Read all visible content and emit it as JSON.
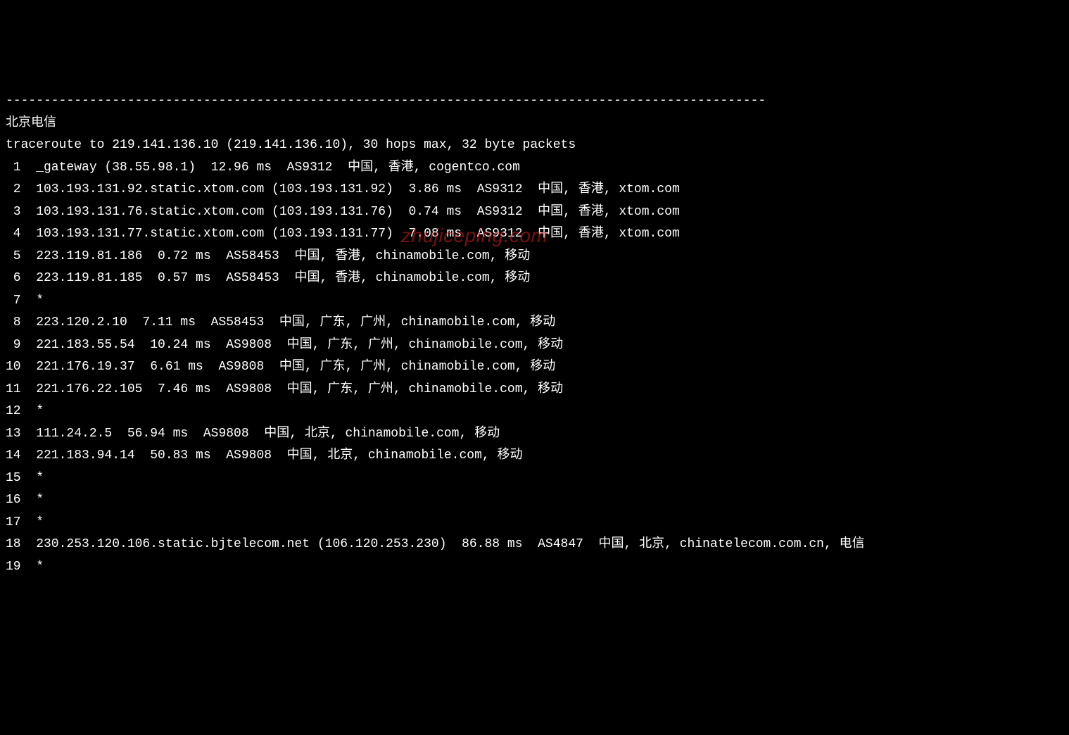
{
  "separator": "----------------------------------------------------------------------------------------------------",
  "title": "北京电信",
  "header": "traceroute to 219.141.136.10 (219.141.136.10), 30 hops max, 32 byte packets",
  "watermark": "zhujiceping.com",
  "hops": [
    {
      "n": " 1",
      "text": "_gateway (38.55.98.1)  12.96 ms  AS9312  中国, 香港, cogentco.com"
    },
    {
      "n": " 2",
      "text": "103.193.131.92.static.xtom.com (103.193.131.92)  3.86 ms  AS9312  中国, 香港, xtom.com"
    },
    {
      "n": " 3",
      "text": "103.193.131.76.static.xtom.com (103.193.131.76)  0.74 ms  AS9312  中国, 香港, xtom.com"
    },
    {
      "n": " 4",
      "text": "103.193.131.77.static.xtom.com (103.193.131.77)  7.08 ms  AS9312  中国, 香港, xtom.com"
    },
    {
      "n": " 5",
      "text": "223.119.81.186  0.72 ms  AS58453  中国, 香港, chinamobile.com, 移动"
    },
    {
      "n": " 6",
      "text": "223.119.81.185  0.57 ms  AS58453  中国, 香港, chinamobile.com, 移动"
    },
    {
      "n": " 7",
      "text": "*"
    },
    {
      "n": " 8",
      "text": "223.120.2.10  7.11 ms  AS58453  中国, 广东, 广州, chinamobile.com, 移动"
    },
    {
      "n": " 9",
      "text": "221.183.55.54  10.24 ms  AS9808  中国, 广东, 广州, chinamobile.com, 移动"
    },
    {
      "n": "10",
      "text": "221.176.19.37  6.61 ms  AS9808  中国, 广东, 广州, chinamobile.com, 移动"
    },
    {
      "n": "11",
      "text": "221.176.22.105  7.46 ms  AS9808  中国, 广东, 广州, chinamobile.com, 移动"
    },
    {
      "n": "12",
      "text": "*"
    },
    {
      "n": "13",
      "text": "111.24.2.5  56.94 ms  AS9808  中国, 北京, chinamobile.com, 移动"
    },
    {
      "n": "14",
      "text": "221.183.94.14  50.83 ms  AS9808  中国, 北京, chinamobile.com, 移动"
    },
    {
      "n": "15",
      "text": "*"
    },
    {
      "n": "16",
      "text": "*"
    },
    {
      "n": "17",
      "text": "*"
    },
    {
      "n": "18",
      "text": "230.253.120.106.static.bjtelecom.net (106.120.253.230)  86.88 ms  AS4847  中国, 北京, chinatelecom.com.cn, 电信"
    },
    {
      "n": "19",
      "text": "*"
    }
  ]
}
